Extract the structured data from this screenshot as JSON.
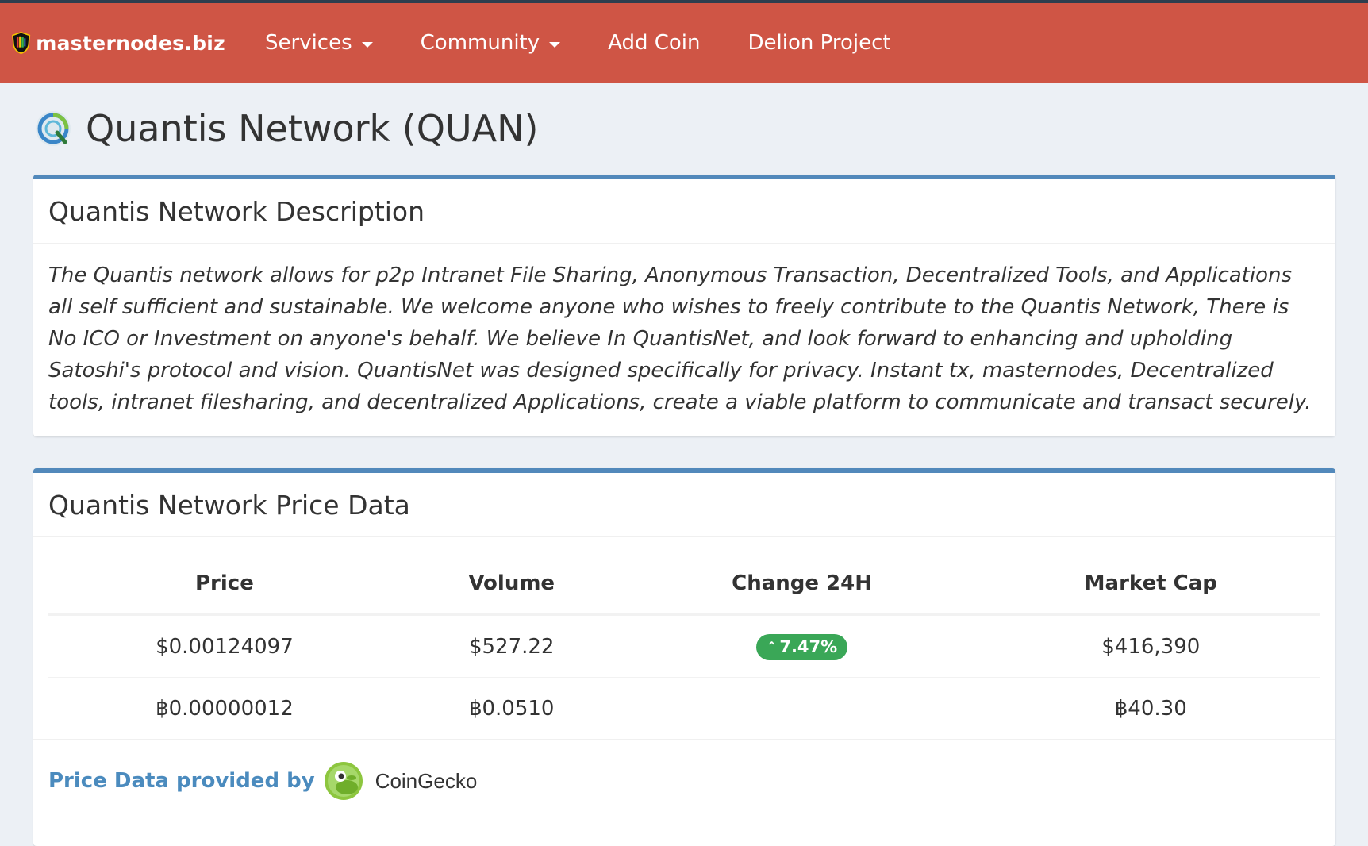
{
  "nav": {
    "brand": "masternodes.biz",
    "items": [
      {
        "label": "Services",
        "dropdown": true
      },
      {
        "label": "Community",
        "dropdown": true
      },
      {
        "label": "Add Coin",
        "dropdown": false
      },
      {
        "label": "Delion Project",
        "dropdown": false
      }
    ],
    "colors": {
      "navbar": "#cf5545",
      "accent": "#5289bb"
    }
  },
  "page": {
    "title": "Quantis Network (QUAN)",
    "logo_icon": "quantis-logo-icon"
  },
  "description": {
    "heading": "Quantis Network Description",
    "text": "The Quantis network allows for p2p Intranet File Sharing, Anonymous Transaction, Decentralized Tools, and Applications all self sufficient and sustainable. We welcome anyone who wishes to freely contribute to the Quantis Network, There is No ICO or Investment on anyone's behalf. We believe In QuantisNet, and look forward to enhancing and upholding Satoshi's protocol and vision. QuantisNet was designed specifically for privacy. Instant tx, masternodes, Decentralized tools, intranet filesharing, and decentralized Applications, create a viable platform to communicate and transact securely."
  },
  "price_data": {
    "heading": "Quantis Network Price Data",
    "columns": [
      "Price",
      "Volume",
      "Change 24H",
      "Market Cap"
    ],
    "usd": {
      "price": "$0.00124097",
      "volume": "$527.22",
      "change": "7.47%",
      "change_direction": "up",
      "market_cap": "$416,390"
    },
    "btc": {
      "price": "฿0.00000012",
      "volume": "฿0.0510",
      "change": "",
      "market_cap": "฿40.30"
    },
    "provider_label": "Price Data provided by",
    "provider_name": "CoinGecko",
    "badge_color": "#3aa757"
  }
}
